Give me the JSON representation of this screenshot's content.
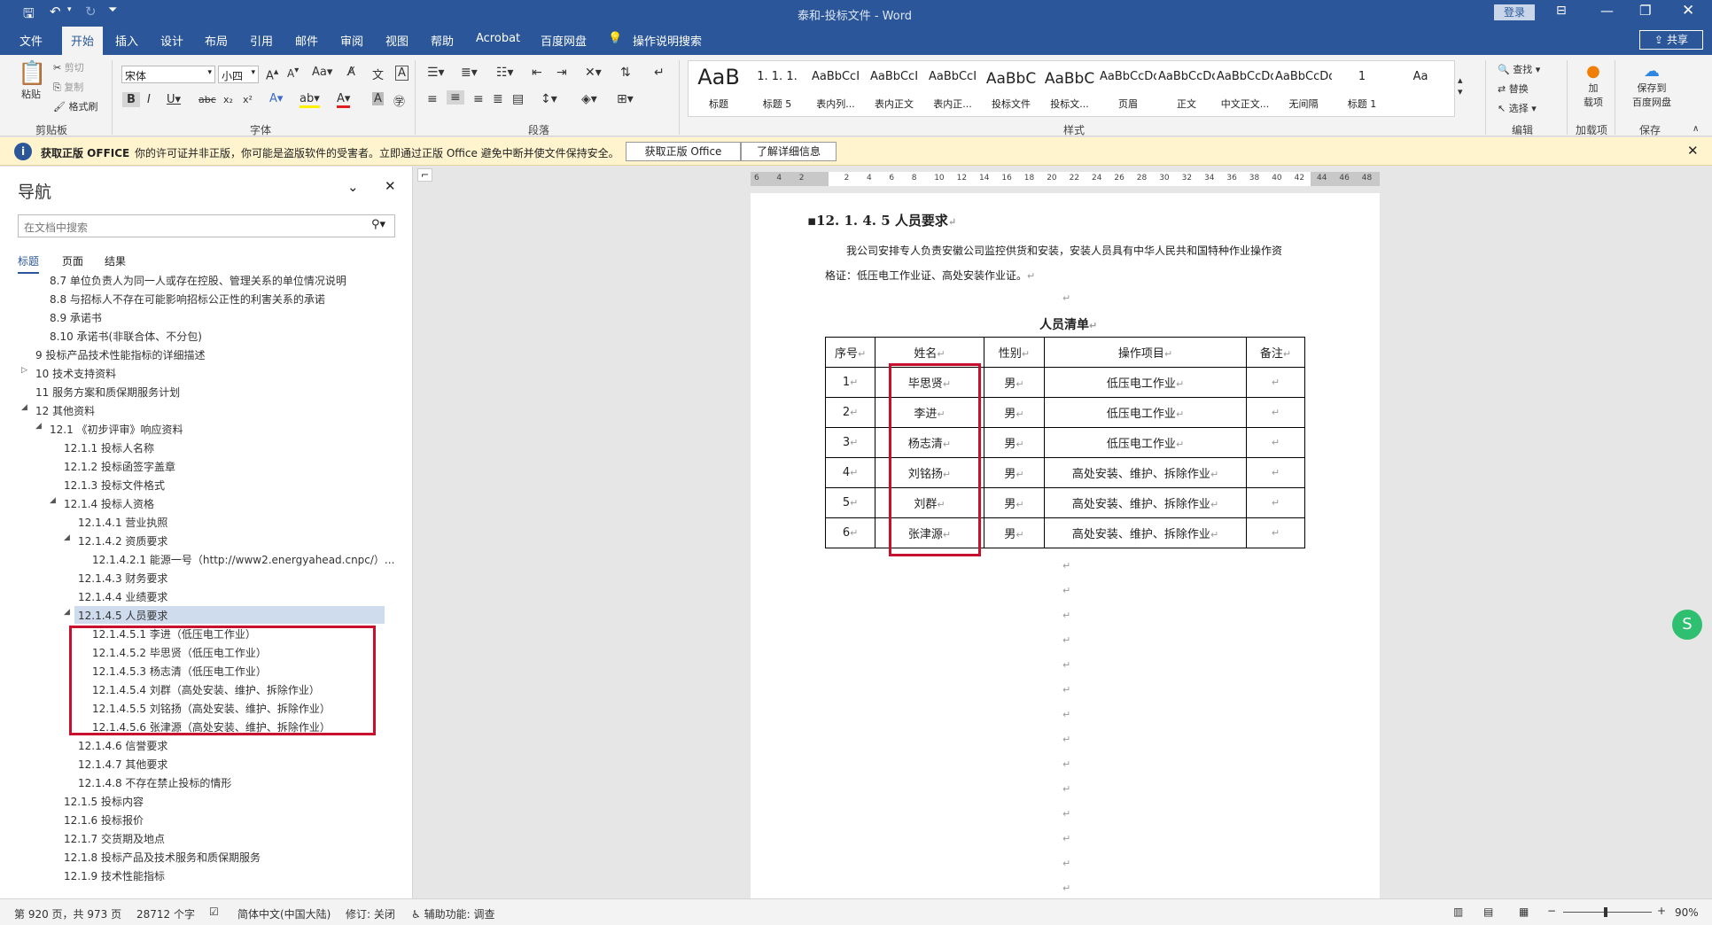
{
  "window": {
    "title": "泰和-投标文件 - Word",
    "login": "登录",
    "share": "共享"
  },
  "tabs": [
    "文件",
    "开始",
    "插入",
    "设计",
    "布局",
    "引用",
    "邮件",
    "审阅",
    "视图",
    "帮助",
    "Acrobat",
    "百度网盘"
  ],
  "tell_me": "操作说明搜索",
  "ribbon": {
    "clipboard": {
      "label": "剪贴板",
      "paste": "粘贴",
      "cut": "剪切",
      "copy": "复制",
      "format_painter": "格式刷"
    },
    "font": {
      "label": "字体",
      "name": "宋体",
      "size": "小四"
    },
    "paragraph": {
      "label": "段落"
    },
    "styles": {
      "label": "样式",
      "items": [
        {
          "preview": "AaB",
          "name": "标题"
        },
        {
          "preview": "1. 1. 1.",
          "name": "标题 5"
        },
        {
          "preview": "AaBbCcI",
          "name": "表内列..."
        },
        {
          "preview": "AaBbCcI",
          "name": "表内正文"
        },
        {
          "preview": "AaBbCcI",
          "name": "表内正..."
        },
        {
          "preview": "AaBbC",
          "name": "投标文件"
        },
        {
          "preview": "AaBbC",
          "name": "投标文..."
        },
        {
          "preview": "AaBbCcDdEe",
          "name": "页眉"
        },
        {
          "preview": "AaBbCcDd",
          "name": "正文"
        },
        {
          "preview": "AaBbCcDd",
          "name": "中文正文..."
        },
        {
          "preview": "AaBbCcDd",
          "name": "无间隔"
        },
        {
          "preview": "1",
          "name": "标题 1"
        },
        {
          "preview": "Aa",
          "name": ""
        }
      ]
    },
    "editing": {
      "label": "编辑",
      "find": "查找",
      "replace": "替换",
      "select": "选择"
    },
    "addins": {
      "label": "加载项",
      "btn": "加\n载项"
    },
    "save": {
      "label": "保存",
      "btn": "保存到\n百度网盘"
    }
  },
  "message_bar": {
    "title": "获取正版 OFFICE",
    "text": "你的许可证并非正版，你可能是盗版软件的受害者。立即通过正版 Office 避免中断并使文件保持安全。",
    "btn1": "获取正版 Office",
    "btn2": "了解详细信息"
  },
  "nav": {
    "title": "导航",
    "search_placeholder": "在文档中搜索",
    "tabs": [
      "标题",
      "页面",
      "结果"
    ],
    "items": [
      {
        "text": "8.7 单位负责人为同一人或存在控股、管理关系的单位情况说明",
        "lvl": 2
      },
      {
        "text": "8.8 与招标人不存在可能影响招标公正性的利害关系的承诺",
        "lvl": 2
      },
      {
        "text": "8.9 承诺书",
        "lvl": 2
      },
      {
        "text": "8.10 承诺书(非联合体、不分包)",
        "lvl": 2
      },
      {
        "text": "9 投标产品技术性能指标的详细描述",
        "lvl": 1
      },
      {
        "text": "10 技术支持资料",
        "lvl": 1,
        "tw": "▷"
      },
      {
        "text": "11 服务方案和质保期服务计划",
        "lvl": 1
      },
      {
        "text": "12 其他资料",
        "lvl": 1,
        "tw": "◢"
      },
      {
        "text": "12.1 《初步评审》响应资料",
        "lvl": 2,
        "tw": "◢"
      },
      {
        "text": "12.1.1 投标人名称",
        "lvl": 3
      },
      {
        "text": "12.1.2 投标函签字盖章",
        "lvl": 3
      },
      {
        "text": "12.1.3 投标文件格式",
        "lvl": 3
      },
      {
        "text": "12.1.4 投标人资格",
        "lvl": 3,
        "tw": "◢"
      },
      {
        "text": "12.1.4.1 营业执照",
        "lvl": 4
      },
      {
        "text": "12.1.4.2 资质要求",
        "lvl": 4,
        "tw": "◢"
      },
      {
        "text": "12.1.4.2.1 能源一号（http://www2.energyahead.cnpc/）...",
        "lvl": 5
      },
      {
        "text": "12.1.4.3 财务要求",
        "lvl": 4
      },
      {
        "text": "12.1.4.4 业绩要求",
        "lvl": 4
      },
      {
        "text": "12.1.4.5 人员要求",
        "lvl": 4,
        "tw": "◢",
        "sel": true
      },
      {
        "text": "12.1.4.5.1 李进（低压电工作业）",
        "lvl": 5
      },
      {
        "text": "12.1.4.5.2 毕思贤（低压电工作业）",
        "lvl": 5
      },
      {
        "text": "12.1.4.5.3 杨志清（低压电工作业）",
        "lvl": 5
      },
      {
        "text": "12.1.4.5.4 刘群（高处安装、维护、拆除作业）",
        "lvl": 5
      },
      {
        "text": "12.1.4.5.5 刘铭扬（高处安装、维护、拆除作业）",
        "lvl": 5
      },
      {
        "text": "12.1.4.5.6 张津源（高处安装、维护、拆除作业）",
        "lvl": 5
      },
      {
        "text": "12.1.4.6 信誉要求",
        "lvl": 4
      },
      {
        "text": "12.1.4.7 其他要求",
        "lvl": 4
      },
      {
        "text": "12.1.4.8 不存在禁止投标的情形",
        "lvl": 4
      },
      {
        "text": "12.1.5 投标内容",
        "lvl": 3
      },
      {
        "text": "12.1.6 投标报价",
        "lvl": 3
      },
      {
        "text": "12.1.7 交货期及地点",
        "lvl": 3
      },
      {
        "text": "12.1.8 投标产品及技术服务和质保期服务",
        "lvl": 3
      },
      {
        "text": "12.1.9 技术性能指标",
        "lvl": 3
      }
    ]
  },
  "ruler": [
    "6",
    "4",
    "2",
    "",
    "2",
    "4",
    "6",
    "8",
    "10",
    "12",
    "14",
    "16",
    "18",
    "20",
    "22",
    "24",
    "26",
    "28",
    "30",
    "32",
    "34",
    "36",
    "38",
    "40",
    "42",
    "44",
    "46",
    "48"
  ],
  "doc": {
    "heading": "12. 1. 4. 5 人员要求",
    "para1": "我公司安排专人负责安徽公司监控供货和安装，安装人员具有中华人民共和国特种作业操作资",
    "para2": "格证：低压电工作业证、高处安装作业证。",
    "table_title": "人员清单",
    "headers": [
      "序号",
      "姓名",
      "性别",
      "操作项目",
      "备注"
    ],
    "rows": [
      [
        "1",
        "毕思贤",
        "男",
        "低压电工作业",
        ""
      ],
      [
        "2",
        "李进",
        "男",
        "低压电工作业",
        ""
      ],
      [
        "3",
        "杨志清",
        "男",
        "低压电工作业",
        ""
      ],
      [
        "4",
        "刘铭扬",
        "男",
        "高处安装、维护、拆除作业",
        ""
      ],
      [
        "5",
        "刘群",
        "男",
        "高处安装、维护、拆除作业",
        ""
      ],
      [
        "6",
        "张津源",
        "男",
        "高处安装、维护、拆除作业",
        ""
      ]
    ]
  },
  "status": {
    "page": "第 920 页，共 973 页",
    "words": "28712 个字",
    "lang": "简体中文(中国大陆)",
    "track": "修订: 关闭",
    "access": "辅助功能: 调查",
    "zoom": "90%"
  }
}
